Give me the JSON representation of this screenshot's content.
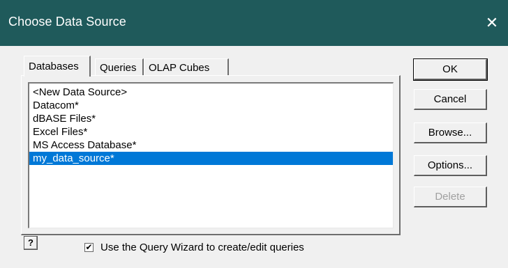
{
  "window": {
    "title": "Choose Data Source",
    "close_glyph": "✕"
  },
  "tabs": [
    {
      "label": "Databases",
      "active": true
    },
    {
      "label": "Queries",
      "active": false
    },
    {
      "label": "OLAP Cubes",
      "active": false
    }
  ],
  "list": {
    "items": [
      {
        "label": "<New Data Source>",
        "selected": false
      },
      {
        "label": "Datacom*",
        "selected": false
      },
      {
        "label": "dBASE Files*",
        "selected": false
      },
      {
        "label": "Excel Files*",
        "selected": false
      },
      {
        "label": "MS Access Database*",
        "selected": false
      },
      {
        "label": "my_data_source*",
        "selected": true
      }
    ],
    "selection_color": "#0078d7"
  },
  "buttons": {
    "ok": "OK",
    "cancel": "Cancel",
    "browse": "Browse...",
    "options": "Options...",
    "delete": "Delete"
  },
  "help": {
    "glyph": "?"
  },
  "query_wizard": {
    "label": "Use the Query Wizard to create/edit queries",
    "checked": true,
    "check_glyph": "✔"
  },
  "colors": {
    "titlebar": "#1f5a5b",
    "dialog_bg": "#f0f0f0"
  }
}
